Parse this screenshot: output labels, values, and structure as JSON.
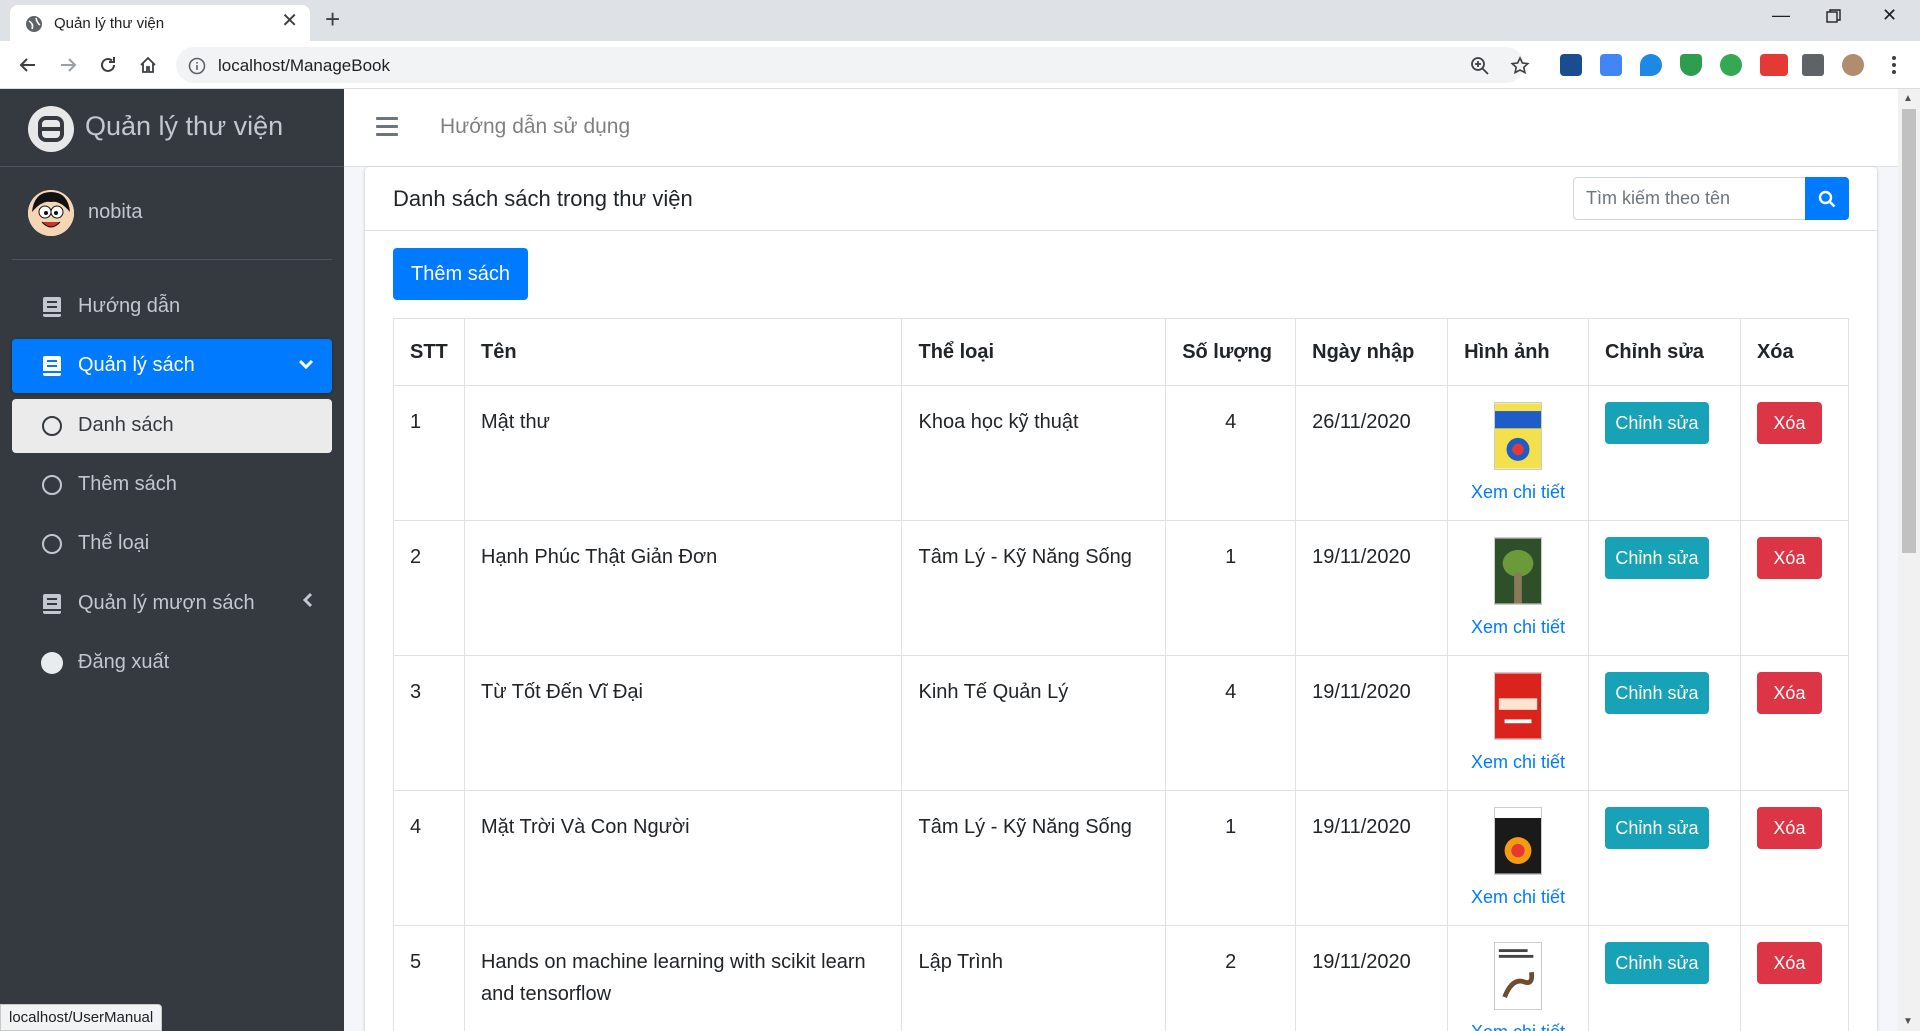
{
  "browser": {
    "tab_title": "Quản lý thư viện",
    "url": "localhost/ManageBook",
    "status_url": "localhost/UserManual"
  },
  "sidebar": {
    "brand": "Quản lý thư viện",
    "username": "nobita",
    "items": [
      {
        "label": "Hướng dẫn",
        "icon": "book-icon"
      },
      {
        "label": "Quản lý sách",
        "icon": "book-icon",
        "caret": "chevron-down-icon"
      },
      {
        "label": "Danh sách",
        "icon": "circle-icon"
      },
      {
        "label": "Thêm sách",
        "icon": "circle-icon"
      },
      {
        "label": "Thể loại",
        "icon": "circle-icon"
      },
      {
        "label": "Quản lý mượn sách",
        "icon": "book-icon",
        "caret": "chevron-left-icon"
      },
      {
        "label": "Đăng xuất",
        "icon": "filled-circle-icon"
      }
    ]
  },
  "topnav": {
    "guide_link": "Hướng dẫn sử dụng"
  },
  "card": {
    "title": "Danh sách sách trong thư viện",
    "search_placeholder": "Tìm kiếm theo tên",
    "add_button": "Thêm sách"
  },
  "table": {
    "headers": [
      "STT",
      "Tên",
      "Thể loại",
      "Số lượng",
      "Ngày nhập",
      "Hình ảnh",
      "Chỉnh sửa",
      "Xóa"
    ],
    "detail_label": "Xem chi tiết",
    "edit_label": "Chỉnh sửa",
    "delete_label": "Xóa",
    "rows": [
      {
        "stt": "1",
        "name": "Mật thư",
        "category": "Khoa học kỹ thuật",
        "qty": "4",
        "date": "26/11/2020"
      },
      {
        "stt": "2",
        "name": "Hạnh Phúc Thật Giản Đơn",
        "category": "Tâm Lý - Kỹ Năng Sống",
        "qty": "1",
        "date": "19/11/2020"
      },
      {
        "stt": "3",
        "name": "Từ Tốt Đến Vĩ Đại",
        "category": "Kinh Tế Quản Lý",
        "qty": "4",
        "date": "19/11/2020"
      },
      {
        "stt": "4",
        "name": "Mặt Trời Và Con Người",
        "category": "Tâm Lý - Kỹ Năng Sống",
        "qty": "1",
        "date": "19/11/2020"
      },
      {
        "stt": "5",
        "name": "Hands on machine learning with scikit learn and tensorflow",
        "category": "Lập Trình",
        "qty": "2",
        "date": "19/11/2020"
      }
    ]
  },
  "colors": {
    "primary": "#007bff",
    "info": "#17a2b8",
    "danger": "#dc3545",
    "sidebar_bg": "#343a40"
  }
}
